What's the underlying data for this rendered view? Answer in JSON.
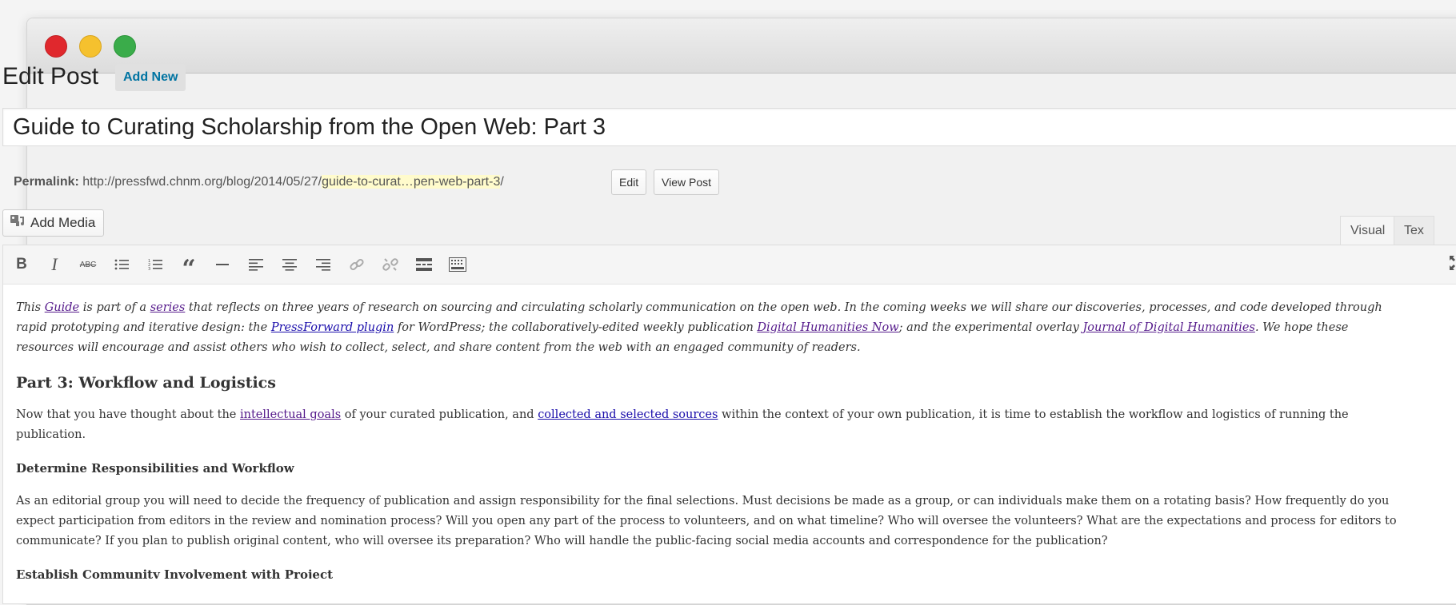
{
  "window": {
    "traffic_lights": [
      "close",
      "minimize",
      "zoom"
    ]
  },
  "header": {
    "title": "Edit Post",
    "add_new": "Add New"
  },
  "post": {
    "title": "Guide to Curating Scholarship from the Open Web: Part 3"
  },
  "permalink": {
    "label": "Permalink:",
    "base": "http://pressfwd.chnm.org/blog/2014/05/27/",
    "slug": "guide-to-curat…pen-web-part-3",
    "trail": "/",
    "edit_button": "Edit",
    "view_button": "View Post"
  },
  "media": {
    "add_media": "Add Media",
    "icon": "add-media-icon"
  },
  "tabs": {
    "visual": "Visual",
    "text": "Tex"
  },
  "toolbar": {
    "buttons": [
      {
        "name": "bold",
        "glyph": "B"
      },
      {
        "name": "italic",
        "glyph": "I"
      },
      {
        "name": "strikethrough",
        "glyph": "ABC"
      },
      {
        "name": "bullet-list",
        "icon": "bullet-list-icon"
      },
      {
        "name": "numbered-list",
        "icon": "numbered-list-icon"
      },
      {
        "name": "blockquote",
        "glyph": "“"
      },
      {
        "name": "horizontal-line",
        "icon": "hr-icon"
      },
      {
        "name": "align-left",
        "icon": "align-left-icon"
      },
      {
        "name": "align-center",
        "icon": "align-center-icon"
      },
      {
        "name": "align-right",
        "icon": "align-right-icon"
      },
      {
        "name": "insert-link",
        "icon": "link-icon"
      },
      {
        "name": "remove-link",
        "icon": "unlink-icon"
      },
      {
        "name": "read-more",
        "icon": "read-more-icon"
      },
      {
        "name": "toolbar-toggle",
        "icon": "kitchen-sink-icon"
      }
    ],
    "fullscreen": "fullscreen-icon"
  },
  "content": {
    "intro": {
      "t1": "This ",
      "guide": "Guide",
      "t2": " is part of a ",
      "series": "series",
      "t3": " that reflects on three years of research on sourcing and circulating scholarly communication on the open web. In the coming weeks we will share our discoveries, processes, and code developed through rapid prototyping and iterative design: the ",
      "pressforward": "PressForward plugin",
      "t4": " for WordPress; the collaboratively-edited weekly publication ",
      "dhnow": "Digital Humanities Now",
      "t5": "; and the experimental overlay ",
      "jdh": "Journal of Digital Humanities",
      "t6": ". We hope these resources will encourage and assist others who wish to collect, select, and share content from the web with an engaged community of readers."
    },
    "part_heading": "Part 3: Workflow and Logistics",
    "para1": {
      "t1": "Now that you have thought about the ",
      "goals": "intellectual goals",
      "t2": " of your curated publication, and ",
      "sources": "collected and selected sources",
      "t3": " within the context of your own publication, it is time to establish the workflow and logistics of running the publication."
    },
    "subheading1": "Determine Responsibilities and Workflow",
    "para2": "As an editorial group you will need to decide the frequency of publication and assign responsibility for the final selections. Must decisions be made as a group, or can individuals make them on a rotating basis? How frequently do you expect participation from editors in the review and nomination process? Will you open any part of the process to volunteers, and on what timeline? Who will oversee the volunteers? What are the expectations and process for editors to communicate? If you plan to publish original content, who will oversee its preparation? Who will handle the public-facing social media accounts and correspondence for the publication?",
    "subheading2": "Establish Community Involvement with Project"
  }
}
